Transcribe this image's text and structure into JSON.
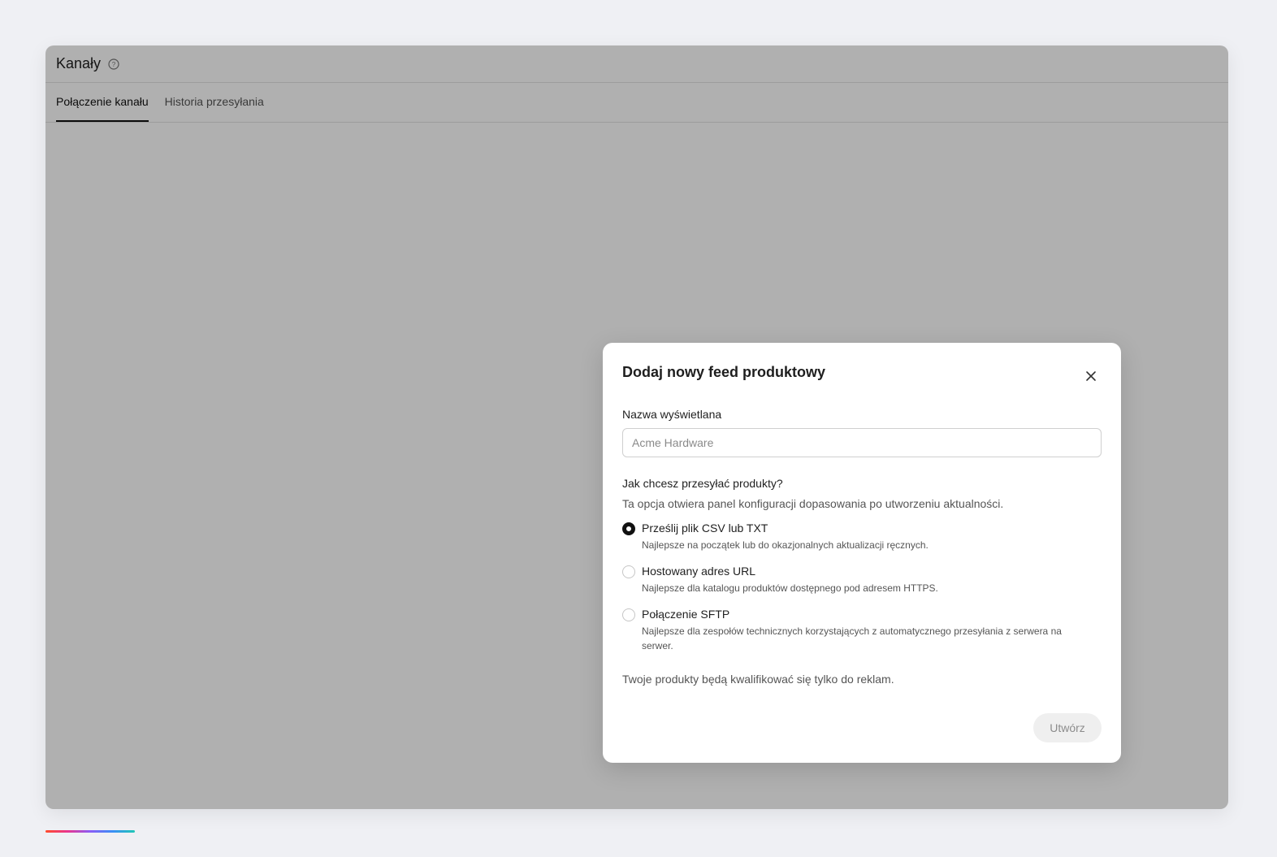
{
  "header": {
    "title": "Kanały",
    "help_icon": "question-circle-icon"
  },
  "tabs": [
    {
      "label": "Połączenie kanału",
      "active": true
    },
    {
      "label": "Historia przesyłania",
      "active": false
    }
  ],
  "modal": {
    "title": "Dodaj nowy feed produktowy",
    "close_icon": "close-icon",
    "name_label": "Nazwa wyświetlana",
    "name_placeholder": "Acme Hardware",
    "name_value": "",
    "question": "Jak chcesz przesyłać produkty?",
    "hint": "Ta opcja otwiera panel konfiguracji dopasowania po utworzeniu aktualności.",
    "options": [
      {
        "label": "Prześlij plik CSV lub TXT",
        "description": "Najlepsze na początek lub do okazjonalnych aktualizacji ręcznych.",
        "selected": true
      },
      {
        "label": "Hostowany adres URL",
        "description": "Najlepsze dla katalogu produktów dostępnego pod adresem HTTPS.",
        "selected": false
      },
      {
        "label": "Połączenie SFTP",
        "description": "Najlepsze dla zespołów technicznych korzystających z automatycznego przesyłania z serwera na serwer.",
        "selected": false
      }
    ],
    "footer_note": "Twoje produkty będą kwalifikować się tylko do reklam.",
    "create_label": "Utwórz"
  },
  "colors": {
    "overlay": "#000000",
    "selected_radio": "#111111",
    "disabled_button_bg": "#efefef",
    "page_background": "#eff0f4"
  }
}
